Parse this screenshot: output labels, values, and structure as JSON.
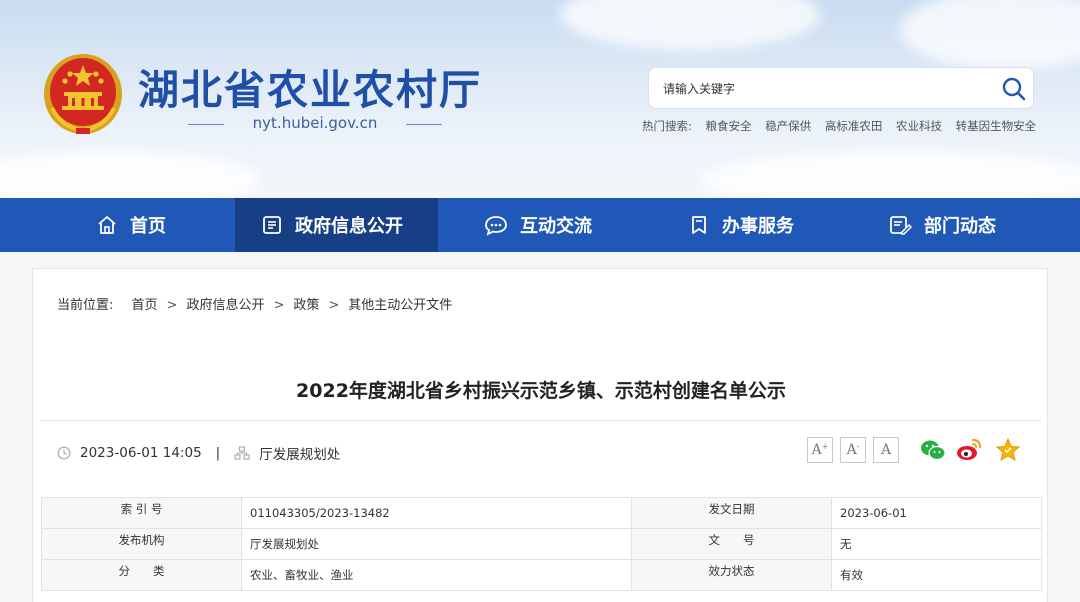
{
  "site": {
    "title": "湖北省农业农村厅",
    "domain": "nyt.hubei.gov.cn"
  },
  "search": {
    "placeholder": "请输入关键字",
    "hot_label": "热门搜索:",
    "hot_keywords": [
      "粮食安全",
      "稳产保供",
      "高标准农田",
      "农业科技",
      "转基因生物安全"
    ]
  },
  "nav": {
    "items": [
      {
        "label": "首页",
        "icon": "home-icon"
      },
      {
        "label": "政府信息公开",
        "icon": "document-list-icon"
      },
      {
        "label": "互动交流",
        "icon": "chat-bubble-icon"
      },
      {
        "label": "办事服务",
        "icon": "bookmark-icon"
      },
      {
        "label": "部门动态",
        "icon": "news-edit-icon"
      }
    ],
    "active_index": 1
  },
  "breadcrumb": {
    "label": "当前位置:",
    "items": [
      "首页",
      "政府信息公开",
      "政策",
      "其他主动公开文件"
    ]
  },
  "article": {
    "title": "2022年度湖北省乡村振兴示范乡镇、示范村创建名单公示",
    "datetime": "2023-06-01 14:05",
    "separator": "|",
    "department": "厅发展规划处"
  },
  "font_buttons": [
    {
      "label": "A",
      "sup": "+"
    },
    {
      "label": "A",
      "sup": "-"
    },
    {
      "label": "A",
      "sup": ""
    }
  ],
  "share": [
    "wechat-icon",
    "weibo-icon",
    "favorite-star-icon"
  ],
  "info_table": {
    "rows": [
      {
        "l1": "索 引 号",
        "v1": "011043305/2023-13482",
        "l2": "发文日期",
        "v2": "2023-06-01"
      },
      {
        "l1": "发布机构",
        "v1": "厅发展规划处",
        "l2": "文　　号",
        "v2": "无"
      },
      {
        "l1": "分　　类",
        "v1": "农业、畜牧业、渔业",
        "l2": "效力状态",
        "v2": "有效"
      }
    ]
  },
  "colors": {
    "brand_blue": "#1f58b6",
    "nav_active": "#163f86",
    "title_blue": "#1f4fa7"
  }
}
